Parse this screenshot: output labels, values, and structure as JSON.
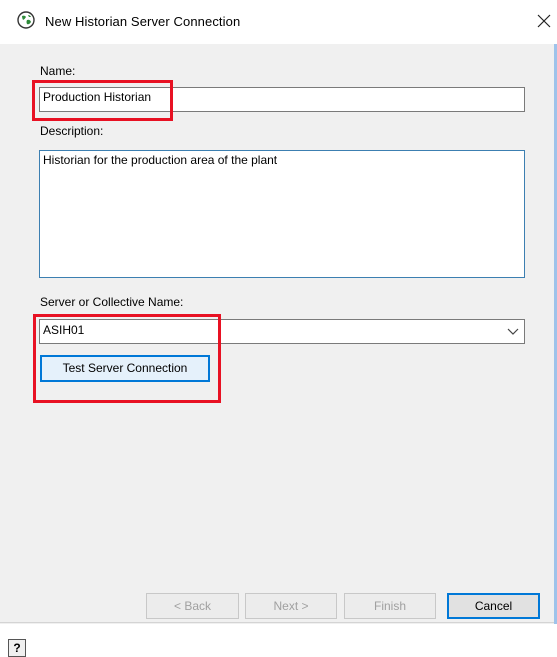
{
  "window": {
    "title": "New Historian Server Connection",
    "close_label": "✕"
  },
  "form": {
    "name_label": "Name:",
    "name_value": "Production Historian",
    "description_label": "Description:",
    "description_value": "Historian for the production area of the plant",
    "server_label": "Server or Collective Name:",
    "server_value": "ASIH01",
    "test_button": "Test Server Connection"
  },
  "footer": {
    "help_label": "?",
    "back_button": "< Back",
    "next_button": "Next >",
    "finish_button": "Finish",
    "cancel_button": "Cancel"
  },
  "colors": {
    "highlight": "#e81123",
    "focus": "#0078d7",
    "dialog_bg": "#f0f0f0"
  },
  "icons": {
    "app": "globe-icon",
    "close": "close-icon",
    "combo": "chevron-down-icon",
    "help": "help-icon"
  }
}
